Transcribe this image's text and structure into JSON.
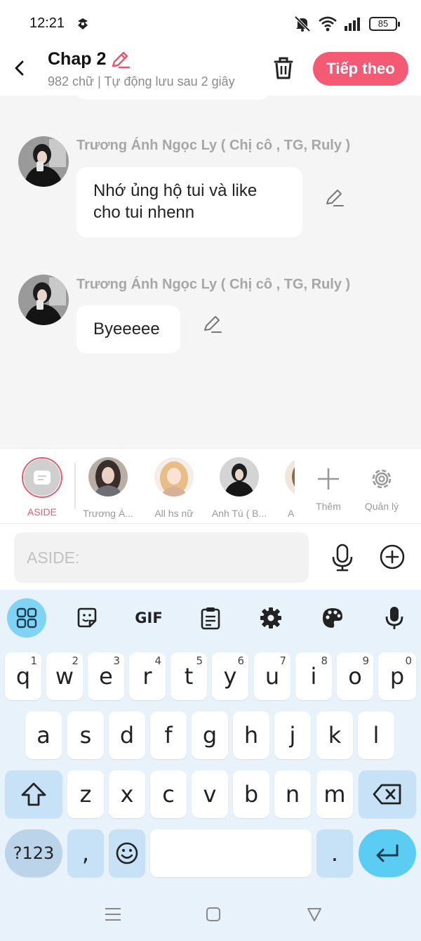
{
  "status": {
    "time": "12:21",
    "battery": "85"
  },
  "header": {
    "title": "Chap 2",
    "subtitle": "982 chữ | Tự động lưu sau 2 giây",
    "next_label": "Tiếp theo"
  },
  "messages": [
    {
      "author": "Trương Ánh Ngọc Ly ( Chị cô , TG, Ruly )",
      "line1": "Nhớ ủng hộ tui và like",
      "line2": "cho tui nhenn"
    },
    {
      "author": "Trương Ánh Ngọc Ly ( Chị cô , TG, Ruly )",
      "line1": "Byeeeee"
    }
  ],
  "characters": {
    "aside_label": "ASIDE",
    "items": [
      "Trương Á...",
      "All hs nữ",
      "Anh Tú ( B...",
      "A"
    ],
    "more_label": "Thêm",
    "manage_label": "Quản lý"
  },
  "input": {
    "placeholder": "ASIDE:"
  },
  "keyboard": {
    "row1": [
      "q",
      "w",
      "e",
      "r",
      "t",
      "y",
      "u",
      "i",
      "o",
      "p"
    ],
    "row1_nums": [
      "1",
      "2",
      "3",
      "4",
      "5",
      "6",
      "7",
      "8",
      "9",
      "0"
    ],
    "row2": [
      "a",
      "s",
      "d",
      "f",
      "g",
      "h",
      "j",
      "k",
      "l"
    ],
    "row3": [
      "z",
      "x",
      "c",
      "v",
      "b",
      "n",
      "m"
    ],
    "sym_label": "?123",
    "comma": ",",
    "period": ".",
    "gif_label": "GIF"
  },
  "colors": {
    "accent": "#f55a74",
    "keyboard_bg": "#e8f2fa",
    "enter_key": "#5bcdf3"
  }
}
